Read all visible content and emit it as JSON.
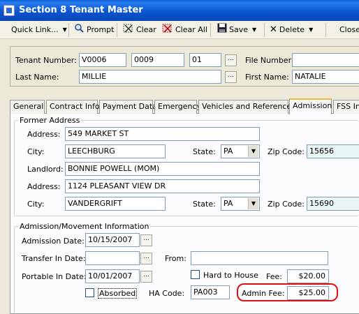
{
  "window": {
    "title": "Section 8 Tenant Master"
  },
  "toolbar": {
    "quick_link": "Quick Link...",
    "prompt": "Prompt",
    "clear": "Clear",
    "clear_all": "Clear All",
    "save": "Save",
    "delete": "Delete",
    "close": "Close"
  },
  "header": {
    "tenant_number_label": "Tenant Number:",
    "tenant_number_1": "V0006",
    "tenant_number_2": "0009",
    "tenant_number_3": "01",
    "file_number_label": "File Number:",
    "file_number": "",
    "last_name_label": "Last Name:",
    "last_name": "MILLIE",
    "first_name_label": "First Name:",
    "first_name": "NATALIE",
    "lookup_button": "..."
  },
  "tabs": [
    "General",
    "Contract Info",
    "Payment Data",
    "Emergency",
    "Vehicles and References",
    "Admission",
    "FSS Info"
  ],
  "former_address": {
    "title": "Former Address",
    "address_label": "Address:",
    "address": "549 MARKET ST",
    "city_label": "City:",
    "city": "LEECHBURG",
    "state_label": "State:",
    "state": "PA",
    "zip_label": "Zip Code:",
    "zip": "15656",
    "landlord_label": "Landlord:",
    "landlord": "BONNIE POWELL (MOM)",
    "address2_label": "Address:",
    "address2": "1124 PLEASANT VIEW DR",
    "city2_label": "City:",
    "city2": "VANDERGRIFT",
    "state2_label": "State:",
    "state2": "PA",
    "zip2_label": "Zip Code:",
    "zip2": "15690"
  },
  "admission": {
    "title": "Admission/Movement Information",
    "admission_date_label": "Admission Date:",
    "admission_date": "10/15/2007",
    "transfer_in_label": "Transfer In Date:",
    "transfer_in_date": "",
    "from_label": "From:",
    "from": "",
    "portable_in_label": "Portable In Date:",
    "portable_in_date": "10/01/2007",
    "hard_to_house_label": "Hard to House",
    "fee_label": "Fee:",
    "fee": "$20.00",
    "absorbed_label": "Absorbed",
    "ha_code_label": "HA Code:",
    "ha_code": "PA003",
    "admin_fee_label": "Admin Fee:",
    "admin_fee": "$25.00"
  },
  "colors": {
    "titlebar": "#0a55d0",
    "highlight_ring": "#dd1111",
    "active_tab_accent": "#f5b43c"
  }
}
